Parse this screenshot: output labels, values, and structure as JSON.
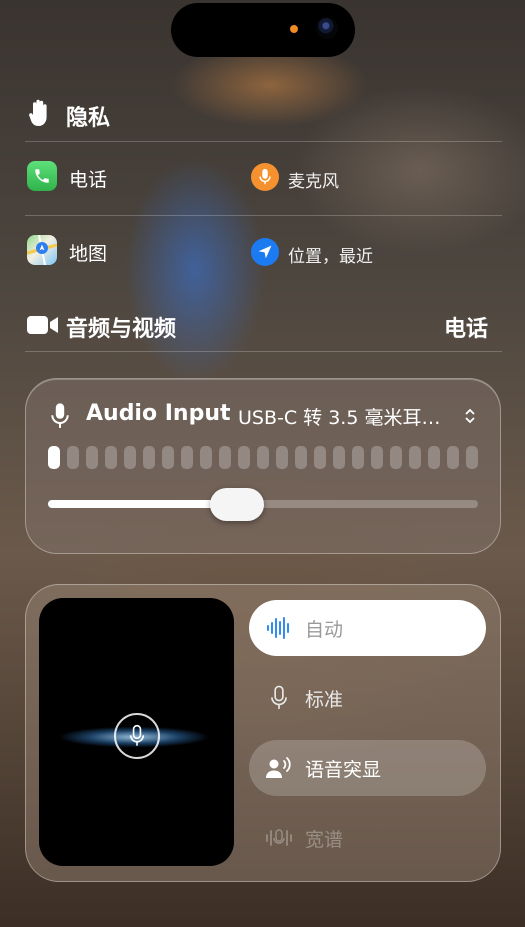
{
  "privacy": {
    "title": "隐私",
    "icon": "hand-icon",
    "items": [
      {
        "label": "电话",
        "icon": "phone-app-icon"
      },
      {
        "label": "麦克风",
        "icon": "microphone-icon"
      },
      {
        "label": "地图",
        "icon": "maps-app-icon"
      },
      {
        "label": "位置，最近",
        "icon": "location-arrow-icon"
      }
    ]
  },
  "av": {
    "title": "音频与视频",
    "icon": "video-camera-icon",
    "app": "电话"
  },
  "audio_input": {
    "title": "Audio Input",
    "device": "USB-C 转 3.5 毫米耳…",
    "meter_segments_total": 23,
    "meter_segments_active": 1,
    "volume_level": 0.44
  },
  "mic_mode": {
    "options": [
      {
        "label": "自动",
        "icon": "waveform-icon",
        "state": "selected"
      },
      {
        "label": "标准",
        "icon": "microphone-icon",
        "state": "normal"
      },
      {
        "label": "语音突显",
        "icon": "voice-isolation-icon",
        "state": "highlighted"
      },
      {
        "label": "宽谱",
        "icon": "wide-spectrum-icon",
        "state": "disabled"
      }
    ]
  },
  "colors": {
    "phone_green": "#34c759",
    "mic_orange": "#f5922f",
    "location_blue": "#1d7bf2",
    "accent_blue": "#2f8cf0"
  }
}
